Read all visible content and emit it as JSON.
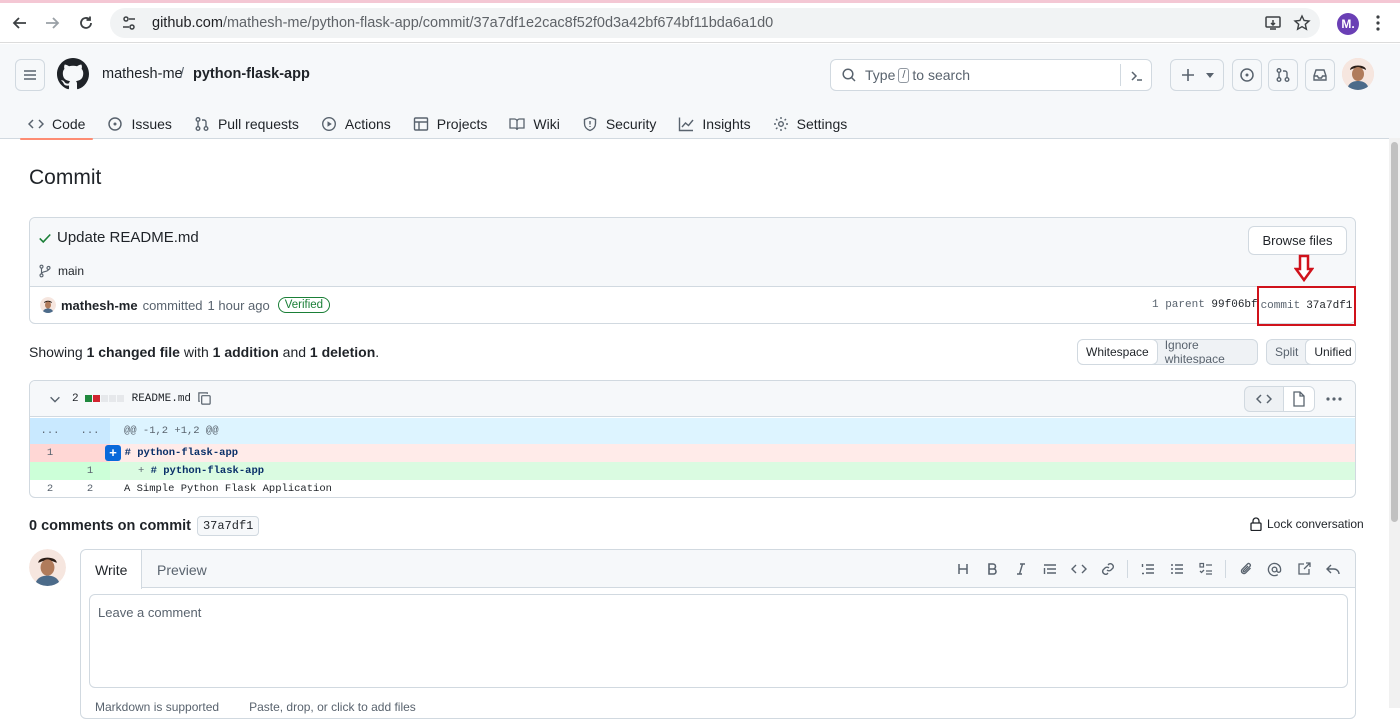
{
  "browser": {
    "url_host": "github.com",
    "url_path": "/mathesh-me/python-flask-app/commit/37a7df1e2cac8f52f0d3a42bf674bf11bda6a1d0",
    "profile_initial": "M."
  },
  "header": {
    "owner": "mathesh-me",
    "separator": "/",
    "repo": "python-flask-app",
    "search_prefix": "Type",
    "search_key": "/",
    "search_suffix": "to search"
  },
  "tabs": [
    {
      "label": "Code",
      "icon": "code-icon",
      "active": true
    },
    {
      "label": "Issues",
      "icon": "issue-icon"
    },
    {
      "label": "Pull requests",
      "icon": "pull-request-icon"
    },
    {
      "label": "Actions",
      "icon": "play-icon"
    },
    {
      "label": "Projects",
      "icon": "table-icon"
    },
    {
      "label": "Wiki",
      "icon": "book-icon"
    },
    {
      "label": "Security",
      "icon": "shield-icon"
    },
    {
      "label": "Insights",
      "icon": "graph-icon"
    },
    {
      "label": "Settings",
      "icon": "gear-icon"
    }
  ],
  "page": {
    "title": "Commit"
  },
  "commit": {
    "message": "Update README.md",
    "branch": "main",
    "browse_label": "Browse files",
    "author": "mathesh-me",
    "action": "committed",
    "time": "1 hour ago",
    "verified": "Verified",
    "parent_label": "1 parent",
    "parent_sha": "99f06bf",
    "commit_label": "commit",
    "sha": "37a7df1"
  },
  "summary": {
    "prefix": "Showing",
    "files": "1 changed file",
    "mid": "with",
    "additions": "1 addition",
    "and": "and",
    "deletions": "1 deletion",
    "end": "."
  },
  "view_options": {
    "whitespace": "Whitespace",
    "ignore_whitespace": "Ignore whitespace",
    "split": "Split",
    "unified": "Unified"
  },
  "diff": {
    "count": "2",
    "filename": "README.md",
    "hunk_left": "...",
    "hunk_right": "...",
    "hunk_header": "@@ -1,2 +1,2 @@",
    "lines": [
      {
        "old": "1",
        "new": "",
        "sign": "-",
        "text": "# python-flask-app"
      },
      {
        "old": "",
        "new": "1",
        "sign": "+",
        "text": "# python-flask-app"
      },
      {
        "old": "2",
        "new": "2",
        "sign": "",
        "text": "A Simple Python Flask Application"
      }
    ]
  },
  "comments": {
    "title": "0 comments on commit",
    "sha": "37a7df1",
    "lock_label": "Lock conversation",
    "write_tab": "Write",
    "preview_tab": "Preview",
    "placeholder": "Leave a comment",
    "footer_markdown": "Markdown is supported",
    "footer_files": "Paste, drop, or click to add files"
  },
  "colors": {
    "accent_underline": "#fd8c73",
    "verified": "#1a7f37",
    "highlight_box": "#d0121b",
    "deletion_bg": "#ffebe9",
    "addition_bg": "#dafbe1",
    "hunk_bg": "#ddf4ff"
  }
}
